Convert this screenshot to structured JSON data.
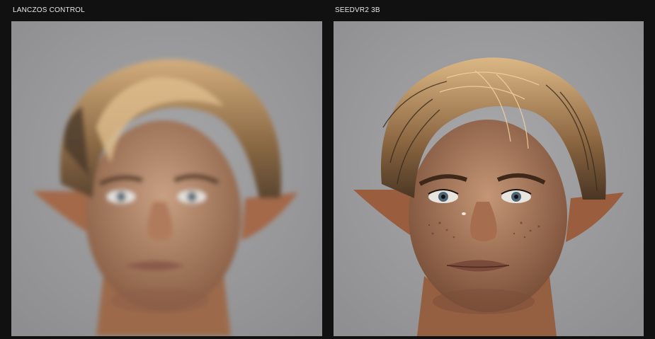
{
  "panels": [
    {
      "label": "LANCZOS CONTROL",
      "image": "portrait-elf-blurry"
    },
    {
      "label": "SEEDVR2 3B",
      "image": "portrait-elf-sharp"
    }
  ]
}
